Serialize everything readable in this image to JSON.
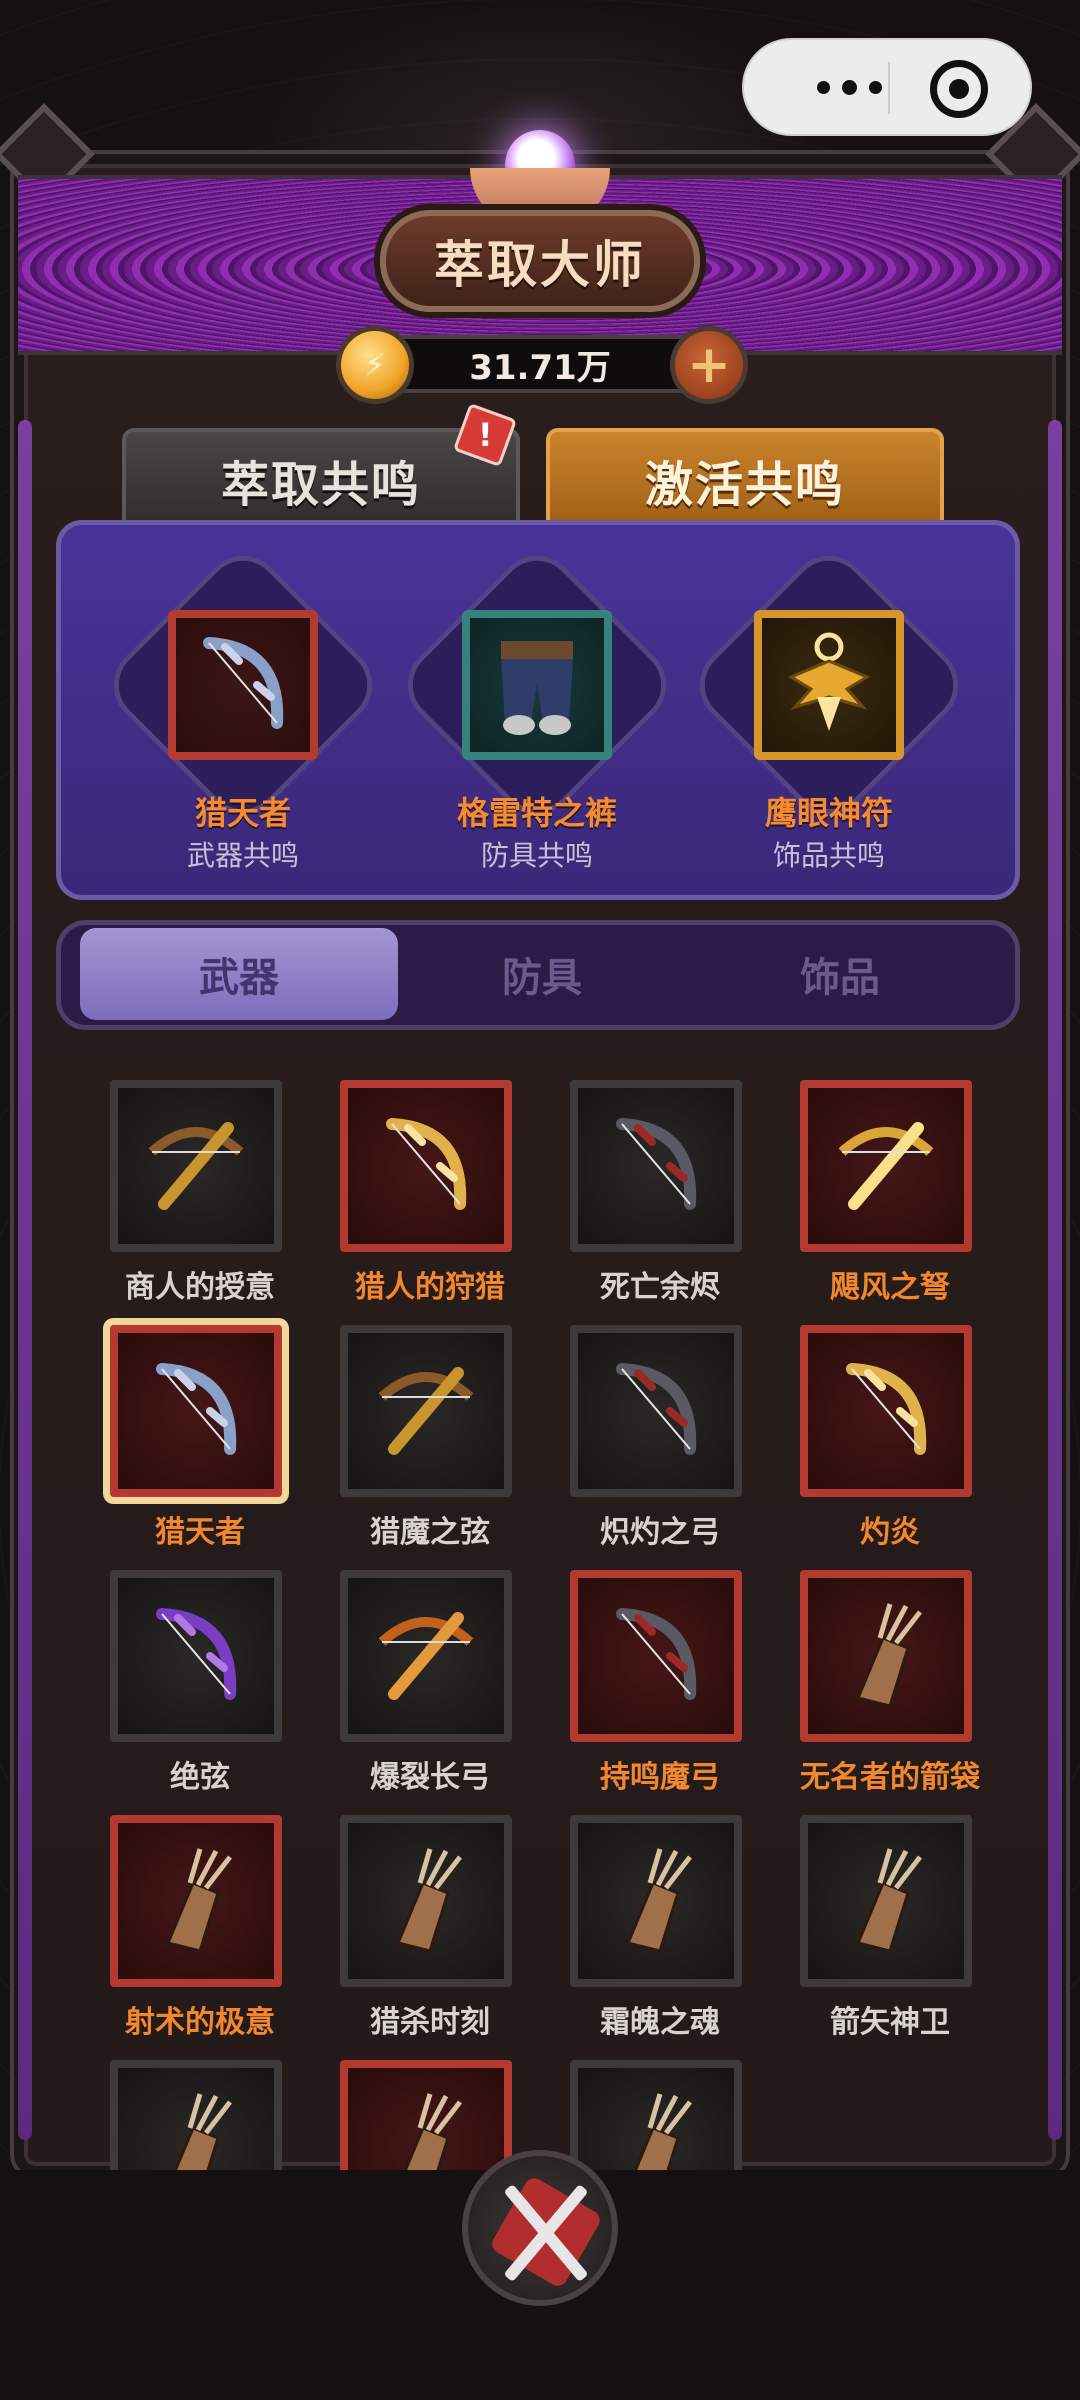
{
  "header": {
    "title": "萃取大师",
    "currency": "31.71万"
  },
  "tabs": [
    {
      "label": "萃取共鸣",
      "active": false,
      "alert": "!"
    },
    {
      "label": "激活共鸣",
      "active": true
    }
  ],
  "resonance": [
    {
      "name": "猎天者",
      "type": "武器共鸣",
      "frame": "red",
      "icon": "bow-icon"
    },
    {
      "name": "格雷特之裤",
      "type": "防具共鸣",
      "frame": "teal",
      "icon": "pants-icon"
    },
    {
      "name": "鹰眼神符",
      "type": "饰品共鸣",
      "frame": "gold",
      "icon": "eagle-amulet-icon"
    }
  ],
  "filters": [
    {
      "label": "武器",
      "active": true
    },
    {
      "label": "防具",
      "active": false
    },
    {
      "label": "饰品",
      "active": false
    }
  ],
  "items": [
    {
      "name": "商人的授意",
      "frame": "gray",
      "icon": "crossbow-icon"
    },
    {
      "name": "猎人的狩猎",
      "frame": "red",
      "icon": "golden-bow-icon"
    },
    {
      "name": "死亡余烬",
      "frame": "gray",
      "icon": "dark-bow-icon"
    },
    {
      "name": "飓风之弩",
      "frame": "red",
      "icon": "golden-crossbow-icon"
    },
    {
      "name": "猎天者",
      "frame": "red",
      "icon": "bow-icon",
      "selected": true
    },
    {
      "name": "猎魔之弦",
      "frame": "gray",
      "icon": "crossbow-icon"
    },
    {
      "name": "炽灼之弓",
      "frame": "gray",
      "icon": "dark-bow-icon"
    },
    {
      "name": "灼炎",
      "frame": "red",
      "icon": "golden-bow-icon"
    },
    {
      "name": "绝弦",
      "frame": "gray",
      "icon": "purple-bow-icon"
    },
    {
      "name": "爆裂长弓",
      "frame": "gray",
      "icon": "orange-crossbow-icon"
    },
    {
      "name": "持鸣魔弓",
      "frame": "red",
      "icon": "dark-bow-icon"
    },
    {
      "name": "无名者的箭袋",
      "frame": "red",
      "icon": "quiver-icon"
    },
    {
      "name": "射术的极意",
      "frame": "red",
      "icon": "quiver-icon"
    },
    {
      "name": "猎杀时刻",
      "frame": "gray",
      "icon": "quiver-icon"
    },
    {
      "name": "霜魄之魂",
      "frame": "gray",
      "icon": "quiver-icon"
    },
    {
      "name": "箭矢神卫",
      "frame": "gray",
      "icon": "quiver-icon"
    },
    {
      "name": "",
      "frame": "gray",
      "icon": "quiver-icon"
    },
    {
      "name": "",
      "frame": "red",
      "icon": "quiver-icon"
    },
    {
      "name": "",
      "frame": "gray",
      "icon": "quiver-icon"
    }
  ],
  "colors": {
    "accent_orange": "#f3872e",
    "rare_red": "#b43a31",
    "banner_purple": "#8f2fb0"
  }
}
